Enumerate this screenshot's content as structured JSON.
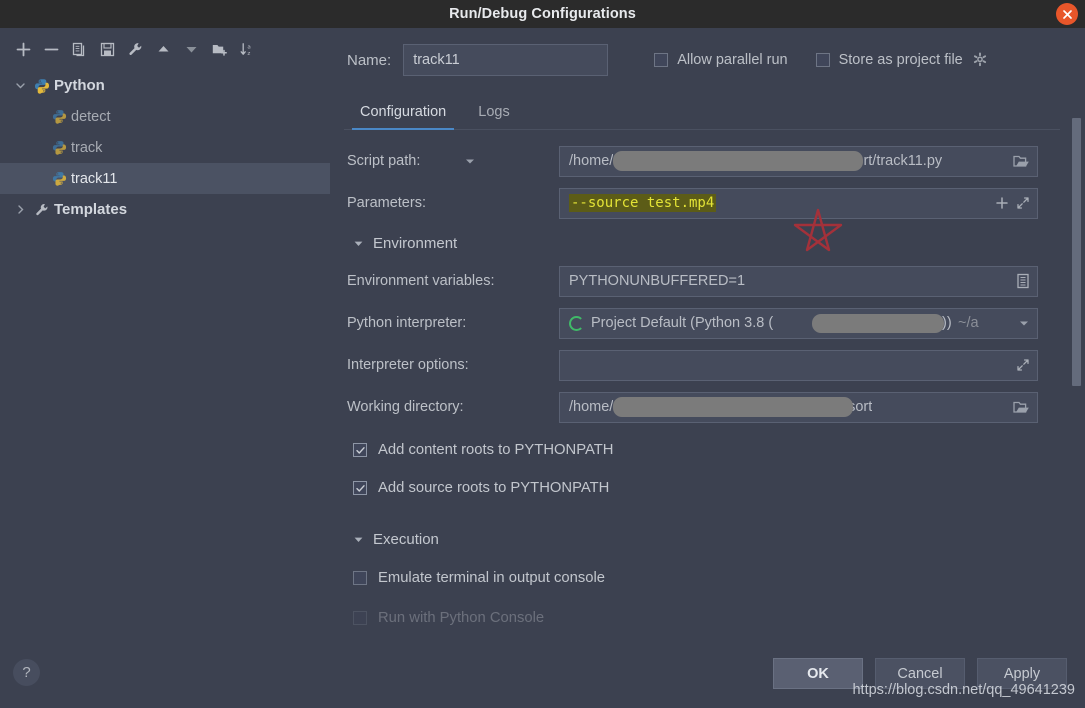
{
  "window": {
    "title": "Run/Debug Configurations",
    "close_icon": "close-icon"
  },
  "toolbar": {
    "buttons": [
      {
        "name": "add-configuration",
        "icon": "plus-icon"
      },
      {
        "name": "remove-configuration",
        "icon": "minus-icon"
      },
      {
        "name": "copy-configuration",
        "icon": "copy-icon"
      },
      {
        "name": "save-configuration",
        "icon": "save-icon"
      },
      {
        "name": "edit-templates",
        "icon": "wrench-icon"
      },
      {
        "name": "move-up",
        "icon": "arrow-up-icon"
      },
      {
        "name": "move-down",
        "icon": "arrow-down-icon"
      },
      {
        "name": "new-folder",
        "icon": "folder-add-icon"
      },
      {
        "name": "sort-alphabetically",
        "icon": "sort-az-icon"
      }
    ]
  },
  "tree": {
    "nodes": [
      {
        "label": "Python",
        "type": "group",
        "expanded": true,
        "icon": "python-icon"
      },
      {
        "label": "detect",
        "type": "child",
        "selected": false,
        "icon": "python-icon"
      },
      {
        "label": "track",
        "type": "child",
        "selected": false,
        "icon": "python-icon"
      },
      {
        "label": "track11",
        "type": "child",
        "selected": true,
        "icon": "python-icon"
      },
      {
        "label": "Templates",
        "type": "group",
        "expanded": false,
        "icon": "wrench-icon"
      }
    ]
  },
  "header": {
    "name_label": "Name:",
    "name_value": "track11",
    "name_placeholder": "Name",
    "allow_parallel_run": {
      "label": "Allow parallel run",
      "checked": false
    },
    "store_as_project_file": {
      "label": "Store as project file",
      "checked": false
    },
    "gear_icon": "gear-icon"
  },
  "tabs": [
    {
      "label": "Configuration",
      "active": true
    },
    {
      "label": "Logs",
      "active": false
    }
  ],
  "form": {
    "script_path": {
      "label": "Script path:",
      "value_prefix": "/home/",
      "value_suffix": "epsort/track11.py",
      "redacted": true,
      "browse_icon": "folder-icon",
      "dropdown_icon": "chevron-down-icon"
    },
    "parameters": {
      "label": "Parameters:",
      "value": "--source test.mp4",
      "insert_icon": "plus-icon",
      "expand_icon": "expand-icon"
    },
    "environment_section": {
      "title": "Environment",
      "expanded": true
    },
    "environment_variables": {
      "label": "Environment variables:",
      "value": "PYTHONUNBUFFERED=1",
      "browse_icon": "list-edit-icon"
    },
    "python_interpreter": {
      "label": "Python interpreter:",
      "value_prefix": "Project Default (Python 3.8 (",
      "value_suffix": "))",
      "value_tail": "~/a",
      "redacted": true,
      "status_icon": "python-env-icon",
      "dropdown_icon": "chevron-down-icon"
    },
    "interpreter_options": {
      "label": "Interpreter options:",
      "value": "",
      "placeholder": "",
      "expand_icon": "expand-icon"
    },
    "working_directory": {
      "label": "Working directory:",
      "value_prefix": "/home/",
      "value_suffix": "psort",
      "redacted": true,
      "browse_icon": "folder-icon"
    },
    "add_content_roots": {
      "label": "Add content roots to PYTHONPATH",
      "checked": true
    },
    "add_source_roots": {
      "label": "Add source roots to PYTHONPATH",
      "checked": true
    },
    "execution_section": {
      "title": "Execution",
      "expanded": true
    },
    "emulate_terminal": {
      "label": "Emulate terminal in output console",
      "checked": false
    },
    "run_with_python_console": {
      "label": "Run with Python Console",
      "checked": false
    }
  },
  "annotation": {
    "shape": "star",
    "color": "#a4313a"
  },
  "footer": {
    "help_label": "?",
    "ok_label": "OK",
    "cancel_label": "Cancel",
    "apply_label": "Apply"
  },
  "watermark": {
    "text": "https://blog.csdn.net/qq_49641239"
  },
  "colors": {
    "accent": "#4a88c7",
    "background": "#3c4150",
    "titlebar": "#2b2b2b",
    "field": "#454b5c",
    "selection": "#4b5263",
    "close": "#e8562a",
    "param_highlight": "#5c5c17",
    "param_text": "#e3e336",
    "interpreter_ok": "#40b968"
  }
}
